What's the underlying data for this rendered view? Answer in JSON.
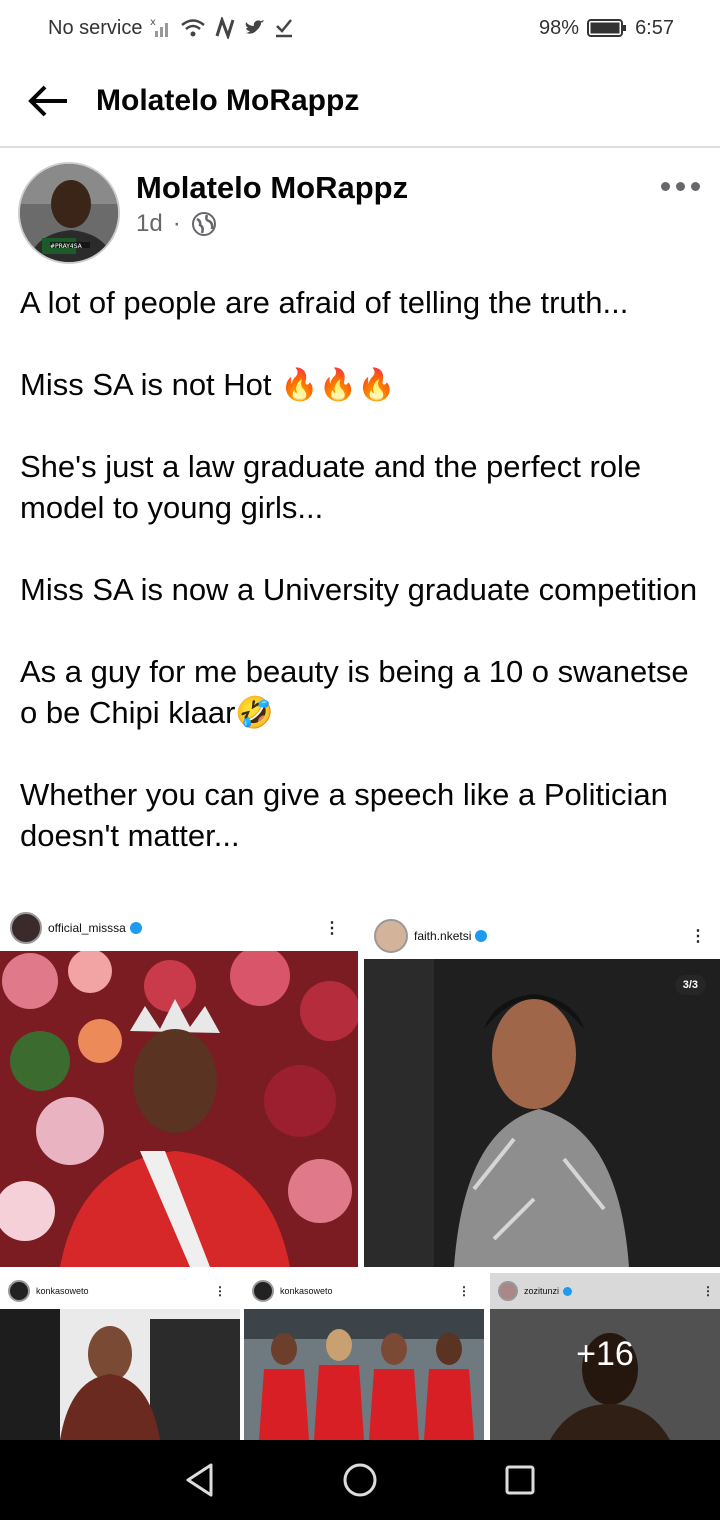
{
  "status_bar": {
    "carrier": "No service",
    "battery": "98%",
    "time": "6:57"
  },
  "app_bar": {
    "title": "Molatelo MoRappz"
  },
  "post": {
    "author": "Molatelo MoRappz",
    "time": "1d",
    "separator": "·",
    "avatar_caption": "#PRAY4SA",
    "paragraphs": [
      "A lot of people are afraid of telling the truth...",
      "Miss SA is not Hot 🔥🔥🔥",
      "She's just a law graduate and the perfect role model to young girls...",
      "Miss SA is now a University graduate competition",
      "As a guy for me beauty is being a 10 o swanetse o be Chipi klaar🤣",
      "Whether you can give a speech like a Politician doesn't matter..."
    ]
  },
  "photos": [
    {
      "username": "official_misssa"
    },
    {
      "username": "faith.nketsi",
      "counter": "3/3"
    },
    {
      "username": "konkasoweto"
    },
    {
      "username": "konkasoweto"
    },
    {
      "username": "zozitunzi",
      "more_count": "+16"
    }
  ],
  "icons": {
    "back": "arrow-left-icon",
    "more": "more-dots-icon",
    "audience": "globe-icon",
    "nav_back": "triangle-back-icon",
    "nav_home": "circle-home-icon",
    "nav_recents": "square-recents-icon"
  }
}
